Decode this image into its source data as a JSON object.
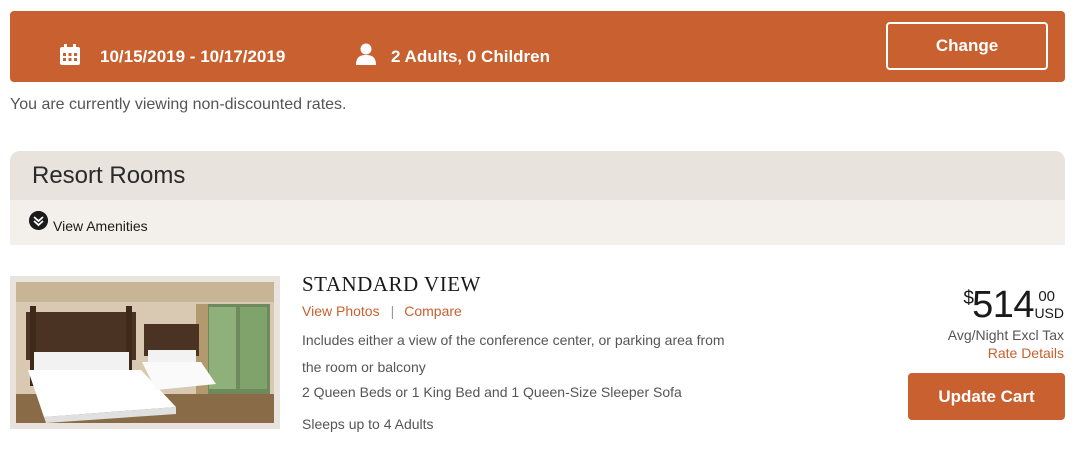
{
  "search": {
    "dates": "10/15/2019 - 10/17/2019",
    "guests": "2 Adults, 0 Children",
    "change_label": "Change",
    "calendar_icon": "calendar-icon",
    "person_icon": "person-icon"
  },
  "rate_note": "You are currently viewing non-discounted rates.",
  "section": {
    "title": "Resort Rooms",
    "amenities_label": "View Amenities",
    "amenities_icon": "chevron-down-circle-icon"
  },
  "room": {
    "name": "STANDARD VIEW",
    "view_photos": "View Photos",
    "separator": "|",
    "compare": "Compare",
    "description": "Includes either a view of the conference center, or parking area from the room or balcony",
    "beds": "2 Queen Beds or 1 King Bed and 1 Queen-Size Sleeper Sofa",
    "occupancy": "Sleeps up to 4 Adults",
    "price": {
      "currency_symbol": "$",
      "amount": "514",
      "cents": "00",
      "currency": "USD",
      "per": "Avg/Night Excl Tax",
      "rate_details": "Rate Details"
    },
    "update_label": "Update Cart"
  },
  "colors": {
    "accent": "#c8602f",
    "section_bg": "#ede9e3"
  }
}
